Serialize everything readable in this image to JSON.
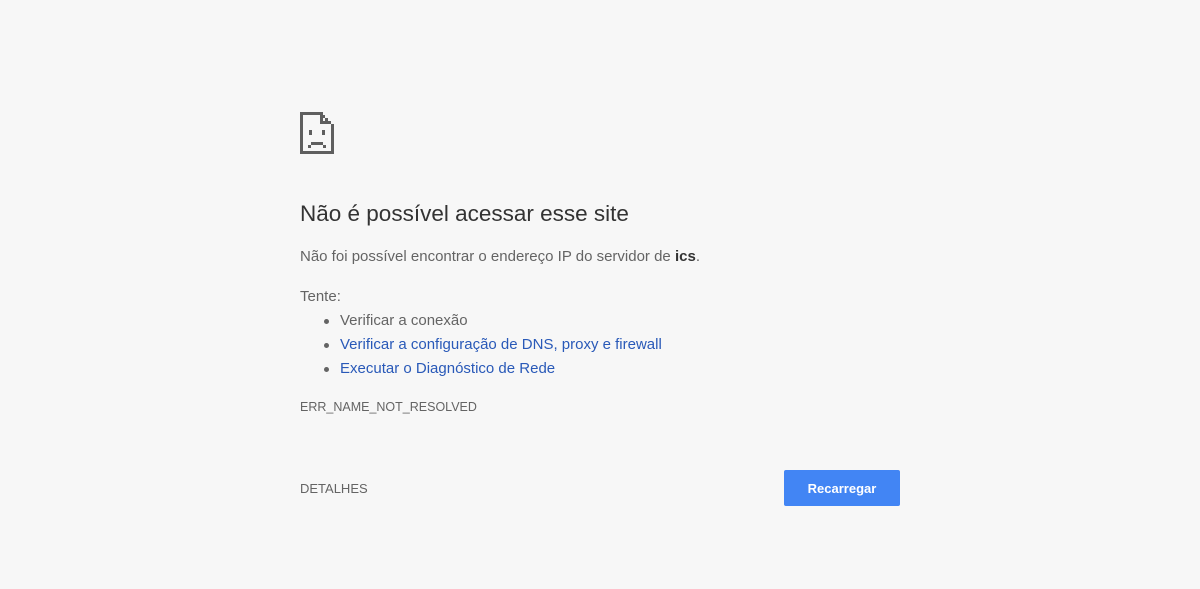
{
  "icon": "sad-document-icon",
  "error": {
    "title": "Não é possível acessar esse site",
    "description_prefix": "Não foi possível encontrar o endereço IP do servidor de ",
    "host": "ics",
    "description_suffix": ".",
    "try_label": "Tente:",
    "suggestions": [
      {
        "label": "Verificar a conexão",
        "is_link": false
      },
      {
        "label": "Verificar a configuração de DNS, proxy e firewall",
        "is_link": true
      },
      {
        "label": "Executar o Diagnóstico de Rede",
        "is_link": true
      }
    ],
    "code": "ERR_NAME_NOT_RESOLVED"
  },
  "buttons": {
    "details_label": "DETALHES",
    "reload_label": "Recarregar"
  },
  "colors": {
    "background": "#f7f7f7",
    "link": "#2959b8",
    "button_primary": "#4285f4",
    "text": "#646464",
    "title": "#333333"
  }
}
